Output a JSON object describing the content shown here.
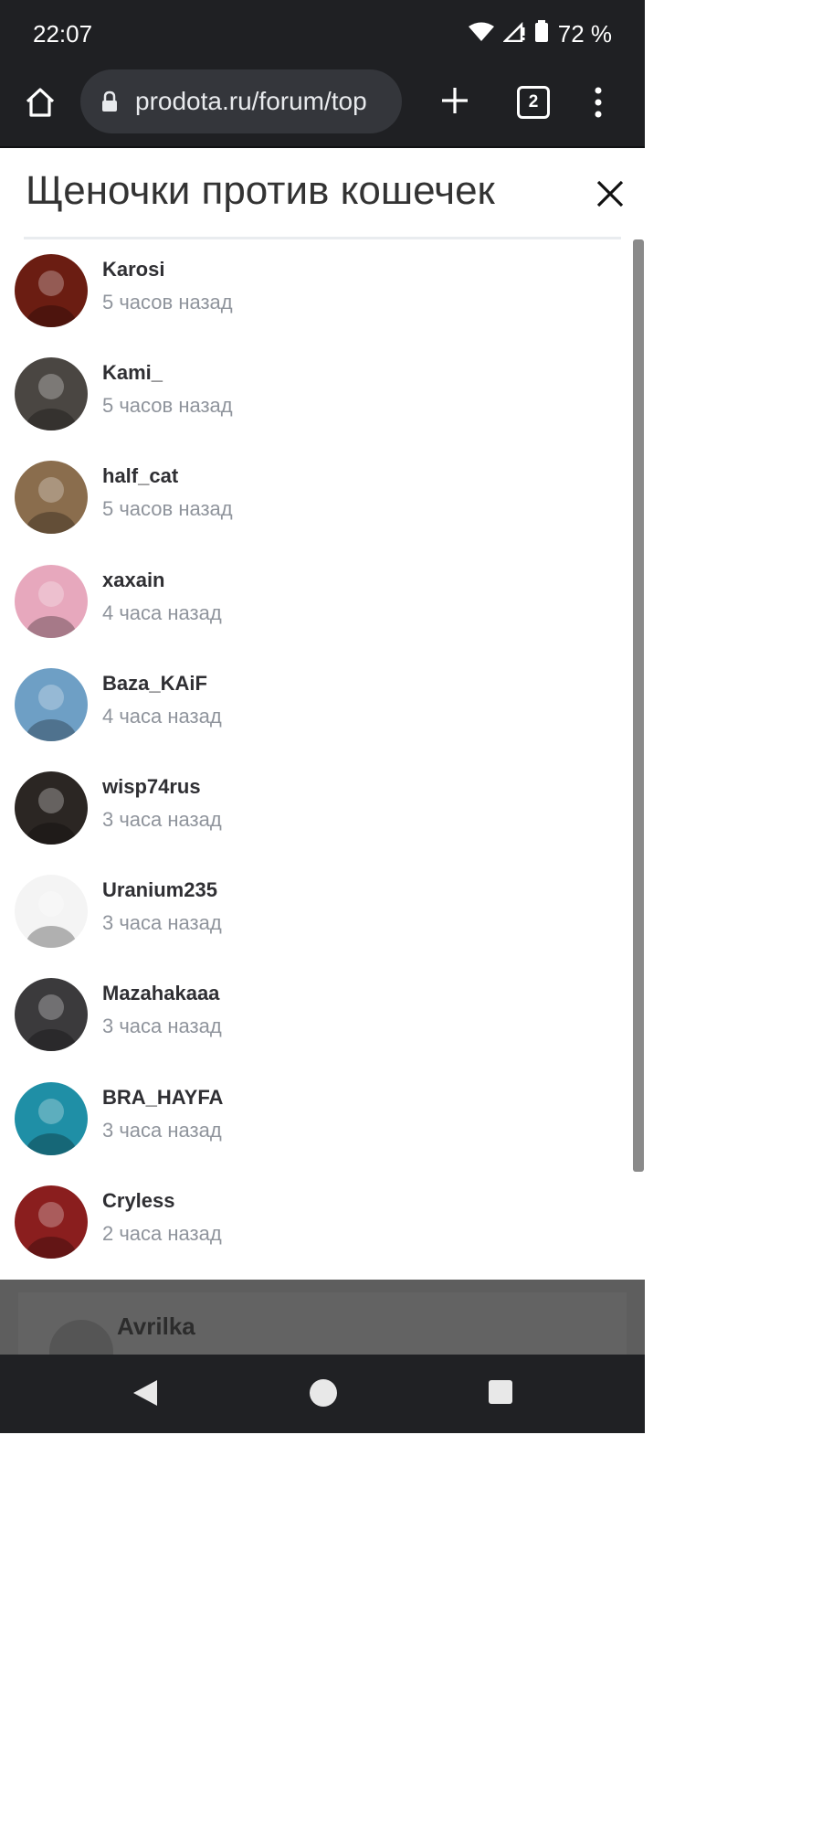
{
  "status_bar": {
    "time": "22:07",
    "battery": "72 %",
    "icons": [
      "wifi-icon",
      "signal-icon",
      "battery-icon"
    ]
  },
  "browser": {
    "url": "prodota.ru/forum/top",
    "tab_count": "2",
    "icons": [
      "home-icon",
      "lock-icon",
      "new-tab-icon",
      "menu-icon"
    ]
  },
  "modal": {
    "title": "Щеночки против кошечек",
    "users": [
      {
        "name": "Karosi",
        "time": "5 часов назад",
        "avatar_color": "#6b1d12"
      },
      {
        "name": "Kami_",
        "time": "5 часов назад",
        "avatar_color": "#4a4642"
      },
      {
        "name": "half_cat",
        "time": "5 часов назад",
        "avatar_color": "#8a6d4d"
      },
      {
        "name": "xaxain",
        "time": "4 часа назад",
        "avatar_color": "#e7a8bd"
      },
      {
        "name": "Baza_KAiF",
        "time": "4 часа назад",
        "avatar_color": "#6e9fc5"
      },
      {
        "name": "wisp74rus",
        "time": "3 часа назад",
        "avatar_color": "#2b2623"
      },
      {
        "name": "Uranium235",
        "time": "3 часа назад",
        "avatar_color": "#f4f4f4"
      },
      {
        "name": "Mazahakaaa",
        "time": "3 часа назад",
        "avatar_color": "#3b3a3c"
      },
      {
        "name": "BRA_HAYFA",
        "time": "3 часа назад",
        "avatar_color": "#1f8fa6"
      },
      {
        "name": "Cryless",
        "time": "2 часа назад",
        "avatar_color": "#8a1e1e"
      }
    ]
  },
  "background": {
    "partial_name": "Avrilka"
  }
}
